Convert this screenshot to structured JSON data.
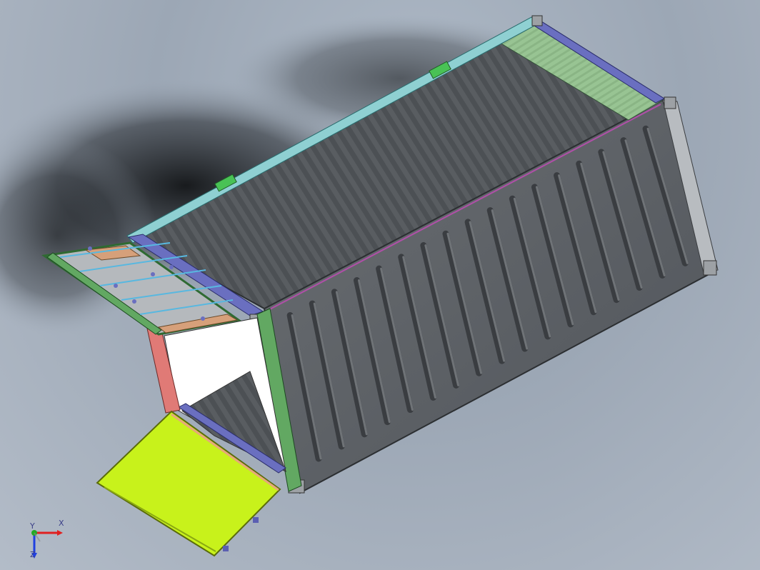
{
  "viewport": {
    "background_color": "#a7b2bf",
    "shadow_color": "#1f2226"
  },
  "model": {
    "description_icon": "shipping-container-3d-model",
    "colors": {
      "body": "#5d6165",
      "interior": "#4a4e52",
      "top_rail": "#8fd0d2",
      "side_rail": "#6a6fc0",
      "corner_post": "#b8bcc0",
      "door_panel_open": "#c8f21b",
      "door_panel_side": "#e07a76",
      "end_panel": "#9fc89a",
      "roof_panel": "#b5b9bd",
      "roof_frame": "#62a862",
      "hinge_clip": "#49c255"
    }
  },
  "triad": {
    "x_label": "X",
    "y_label": "Y",
    "z_label": "Z",
    "x_color": "#e02020",
    "y_color": "#22aa22",
    "z_color": "#2040e0"
  }
}
